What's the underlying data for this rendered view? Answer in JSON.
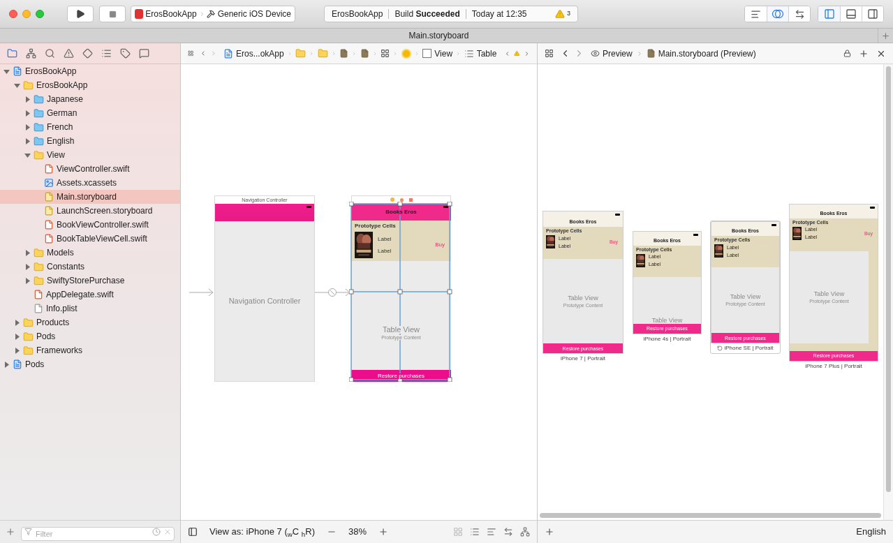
{
  "toolbar": {
    "scheme": "ErosBookApp",
    "destination": "Generic iOS Device",
    "activity": {
      "project": "ErosBookApp",
      "status": "Build **Succeeded**",
      "time": "Today at 12:35",
      "warning_count": "3"
    },
    "editor_modes": [
      {
        "kind": "standard",
        "selected": false
      },
      {
        "kind": "assistant",
        "selected": true
      },
      {
        "kind": "version",
        "selected": false
      }
    ],
    "panels": [
      {
        "kind": "navigator",
        "selected": true
      },
      {
        "kind": "debug",
        "selected": false
      },
      {
        "kind": "utilities",
        "selected": false
      }
    ]
  },
  "tab_bar": {
    "title": "Main.storyboard"
  },
  "navigator": {
    "tabs": [
      {
        "kind": "project",
        "selected": true
      },
      {
        "kind": "symbol",
        "selected": false
      },
      {
        "kind": "find",
        "selected": false
      },
      {
        "kind": "issue",
        "selected": false
      },
      {
        "kind": "test",
        "selected": false
      },
      {
        "kind": "debug",
        "selected": false
      },
      {
        "kind": "breakpoint",
        "selected": false
      },
      {
        "kind": "report",
        "selected": false
      }
    ],
    "tree": [
      {
        "name": "ErosBookApp",
        "kind": "project",
        "expanded": true,
        "selected": false,
        "children": [
          {
            "name": "ErosBookApp",
            "kind": "folder",
            "expanded": true,
            "selected": false,
            "children": [
              {
                "name": "Japanese",
                "kind": "lproj",
                "expanded": false,
                "selected": false
              },
              {
                "name": "German",
                "kind": "lproj",
                "expanded": false,
                "selected": false
              },
              {
                "name": "French",
                "kind": "lproj",
                "expanded": false,
                "selected": false
              },
              {
                "name": "English",
                "kind": "lproj",
                "expanded": false,
                "selected": false
              },
              {
                "name": "View",
                "kind": "folder",
                "expanded": true,
                "selected": false,
                "children": [
                  {
                    "name": "ViewController.swift",
                    "kind": "swift",
                    "selected": false
                  },
                  {
                    "name": "Assets.xcassets",
                    "kind": "assets",
                    "selected": false
                  },
                  {
                    "name": "Main.storyboard",
                    "kind": "storyboard",
                    "selected": true
                  },
                  {
                    "name": "LaunchScreen.storyboard",
                    "kind": "storyboard",
                    "selected": false
                  },
                  {
                    "name": "BookViewController.swift",
                    "kind": "swift",
                    "selected": false
                  },
                  {
                    "name": "BookTableViewCell.swift",
                    "kind": "swift",
                    "selected": false
                  }
                ]
              },
              {
                "name": "Models",
                "kind": "folder",
                "expanded": false,
                "selected": false
              },
              {
                "name": "Constants",
                "kind": "folder",
                "expanded": false,
                "selected": false
              },
              {
                "name": "SwiftyStorePurchase",
                "kind": "folder",
                "expanded": false,
                "selected": false
              },
              {
                "name": "AppDelegate.swift",
                "kind": "swift",
                "selected": false
              },
              {
                "name": "Info.plist",
                "kind": "plist",
                "selected": false
              }
            ]
          },
          {
            "name": "Products",
            "kind": "folder",
            "expanded": false,
            "selected": false
          },
          {
            "name": "Pods",
            "kind": "folder",
            "expanded": false,
            "selected": false
          },
          {
            "name": "Frameworks",
            "kind": "folder",
            "expanded": false,
            "selected": false
          }
        ]
      },
      {
        "name": "Pods",
        "kind": "project",
        "expanded": false,
        "selected": false
      }
    ],
    "filter": {
      "placeholder": "Filter"
    }
  },
  "editor": {
    "jump_bar": [
      {
        "kind": "project",
        "label": "Eros...okApp"
      },
      {
        "kind": "folder"
      },
      {
        "kind": "folder"
      },
      {
        "kind": "file"
      },
      {
        "kind": "file"
      },
      {
        "kind": "scene"
      },
      {
        "kind": "controller"
      },
      {
        "kind": "view",
        "label": "View"
      },
      {
        "kind": "table",
        "label": "Table"
      }
    ],
    "canvas": {
      "nav_controller": {
        "header": "Navigation Controller",
        "label": "Navigation Controller"
      },
      "table_scene": {
        "title": "Books Eros",
        "section": "Prototype Cells",
        "labels": [
          "Label",
          "Label"
        ],
        "buy": "Buy",
        "table_view": "Table View",
        "prototype_content": "Prototype Content",
        "button": "Restore purchases"
      }
    },
    "bottom_bar": {
      "view_as": "View as: iPhone 7 ($_{w}$C $_{h}$R)",
      "zoom": "38%"
    }
  },
  "preview": {
    "jump_bar": [
      {
        "kind": "preview",
        "label": "Preview"
      },
      {
        "kind": "storyboard",
        "label": "Main.storyboard (Preview)"
      }
    ],
    "devices": [
      {
        "caption": "iPhone 7 | Portrait",
        "selected": false,
        "title": "Books Eros",
        "section": "Prototype Cells",
        "labels": [
          "Label",
          "Label"
        ],
        "buy": "Buy",
        "table_view": "Table View",
        "prototype_content": "Prototype Content",
        "button": "Restore purchases"
      },
      {
        "caption": "iPhone 4s | Portrait",
        "selected": false,
        "title": "Books Eros",
        "section": "Prototype Cells",
        "labels": [
          "Label",
          "Label"
        ],
        "table_view": "Table View",
        "button": "Restore purchases"
      },
      {
        "caption": "iPhone SE | Portrait",
        "selected": true,
        "title": "Books Eros",
        "section": "Prototype Cells",
        "labels": [
          "Label",
          "Label"
        ],
        "table_view": "Table View",
        "prototype_content": "Prototype Content",
        "button": "Restore purchases"
      },
      {
        "caption": "iPhone 7 Plus | Portrait",
        "selected": false,
        "title": "Books Eros",
        "section": "Prototype Cells",
        "labels": [
          "Label",
          "Label"
        ],
        "buy": "Buy",
        "table_view": "Table View",
        "prototype_content": "Prototype Content",
        "button": "Restore purchases"
      }
    ],
    "language": "English"
  }
}
